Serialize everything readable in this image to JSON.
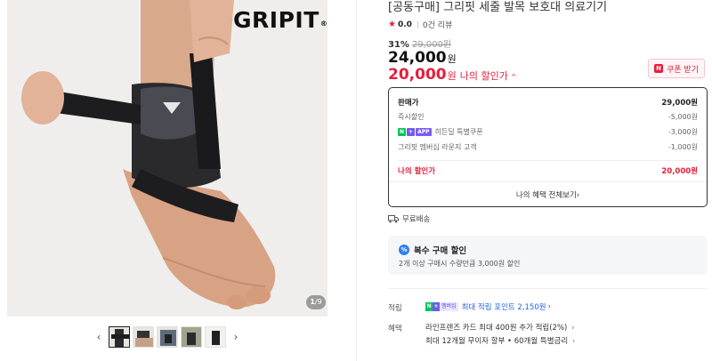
{
  "gallery": {
    "brand_logo": "GRIPIT",
    "brand_logo_mark": "®",
    "counter_current": "1",
    "counter_sep": "/",
    "counter_total": "9",
    "prev_icon": "chevron-left-icon",
    "next_icon": "chevron-right-icon",
    "thumbnail_count": 5,
    "active_thumbnail": 1
  },
  "product": {
    "title": "[공동구매] 그리핏 세줄 발목 보호대 의료기기",
    "rating_score": "0.0",
    "review_count": "0건 리뷰",
    "discount_rate": "31%",
    "original_price": "29,000원",
    "price": "24,000",
    "price_unit": "원",
    "my_price": "20,000",
    "my_price_unit": "원",
    "my_price_label": "나의 할인가",
    "my_price_chevron": "^"
  },
  "coupon": {
    "badge": "N",
    "label": "쿠폰 받기"
  },
  "breakdown": {
    "sale_price_label": "판매가",
    "sale_price_value": "29,000원",
    "rows": [
      {
        "label": "즉시할인",
        "value": "-5,000원"
      },
      {
        "label": "히든딜 특별쿠폰",
        "value": "-3,000원",
        "badges": [
          "N",
          "+",
          "APP"
        ]
      },
      {
        "label": "그리핏 멤버십 라운지 고객",
        "value": "-1,000원"
      }
    ],
    "my_price_label": "나의 할인가",
    "my_price_value": "20,000원",
    "view_all": "나의 혜택 전체보기",
    "view_all_chevron": "›"
  },
  "delivery": {
    "label": "무료배송",
    "icon": "truck-icon"
  },
  "multi_purchase": {
    "icon_text": "%",
    "title": "복수 구매 할인",
    "description": "2개 이상 구매시 수량만큼 3,000원 할인"
  },
  "details": {
    "points_label": "적립",
    "points_badge_n": "N",
    "points_badge_plus": "+",
    "points_badge_member": "멤버십",
    "points_text": "최대 적립 포인트 2,150원",
    "benefit_label": "혜택",
    "benefit_line1": "라인프렌즈 카드 최대 400원 추가 적립(2%)",
    "benefit_line2": "최대 12개월 무이자 할부 • 60개월 특별금리",
    "chevron": "›"
  },
  "colors": {
    "accent_red": "#e61e3c",
    "link_blue": "#2b63e0",
    "naver_green": "#03c75a",
    "membership_purple": "#6e5bf2"
  }
}
